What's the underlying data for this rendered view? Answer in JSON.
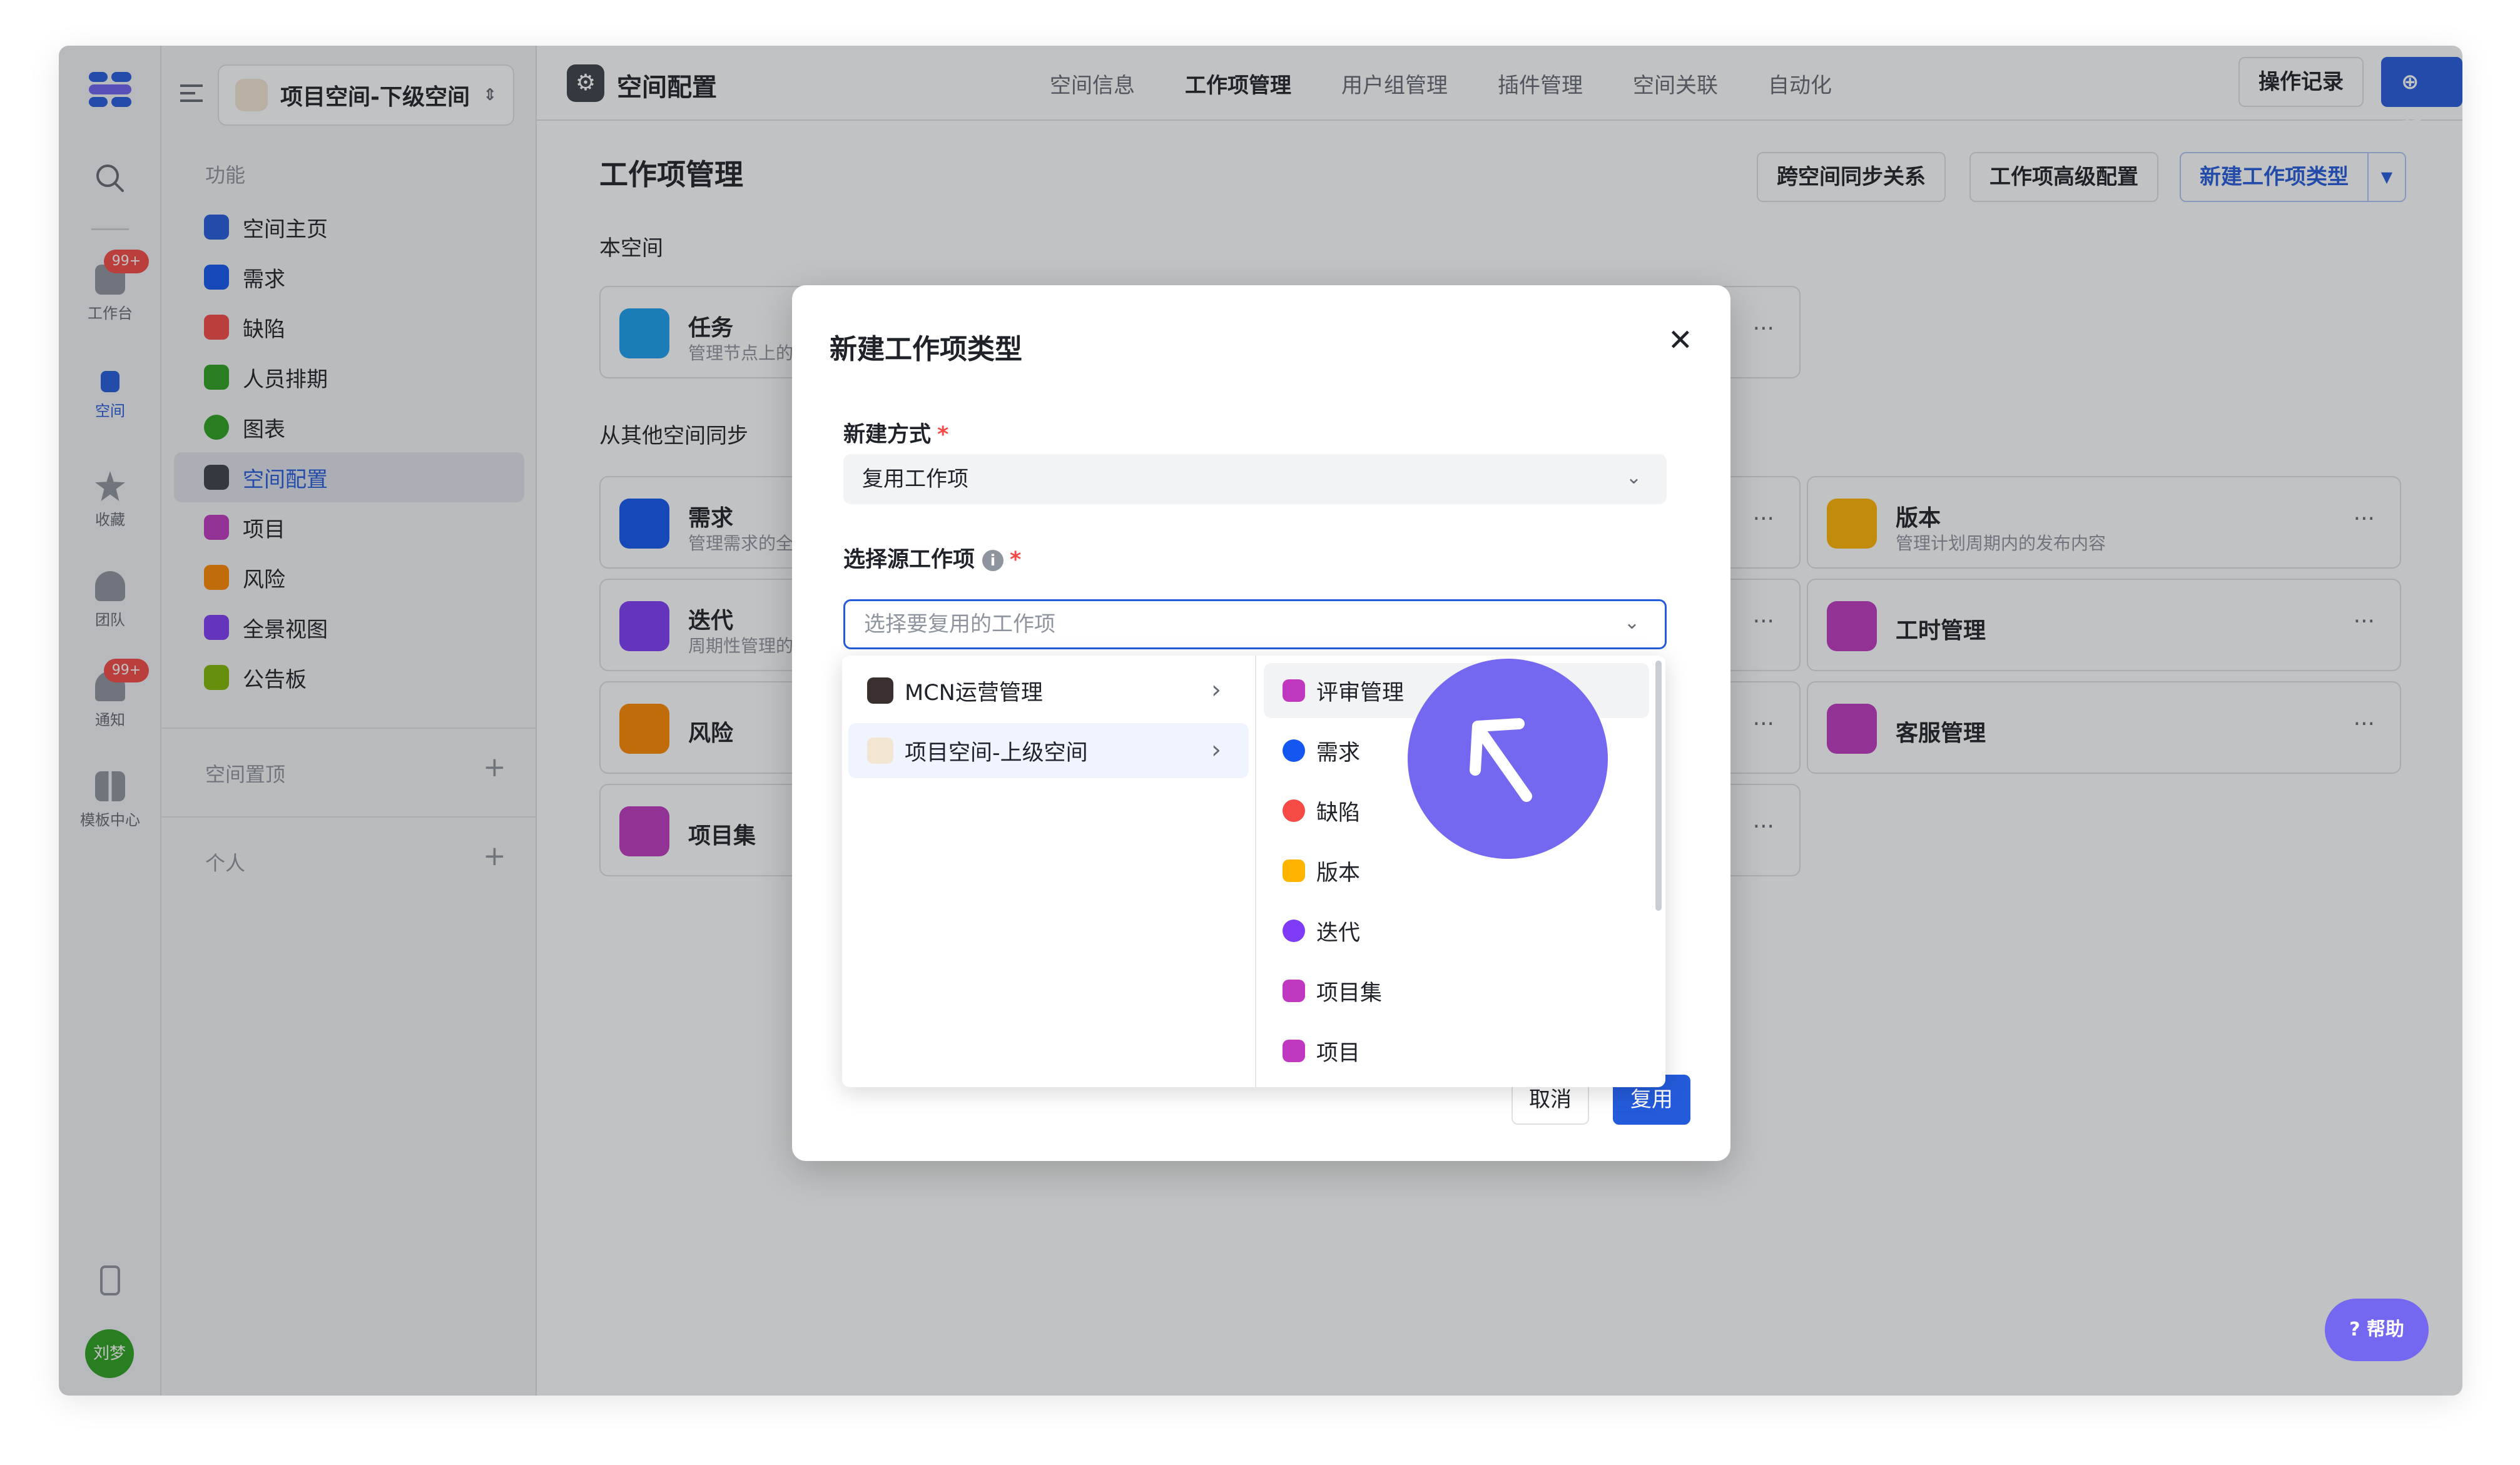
{
  "rail": {
    "items": [
      {
        "label": "工作台",
        "badge": "99+",
        "icon": "workbench-icon"
      },
      {
        "label": "空间",
        "icon": "space-icon"
      },
      {
        "label": "收藏",
        "icon": "star-icon"
      },
      {
        "label": "团队",
        "icon": "team-icon"
      },
      {
        "label": "通知",
        "badge": "99+",
        "icon": "bell-icon"
      },
      {
        "label": "模板中心",
        "icon": "template-icon"
      }
    ],
    "avatar": "刘梦"
  },
  "nav": {
    "space_name": "项目空间-下级空间",
    "section_function": "功能",
    "items": [
      {
        "label": "空间主页",
        "color": "#245bdb"
      },
      {
        "label": "需求",
        "color": "#1456f0"
      },
      {
        "label": "缺陷",
        "color": "#f54a45"
      },
      {
        "label": "人员排期",
        "color": "#2ea121"
      },
      {
        "label": "图表",
        "color": "#2ea121"
      },
      {
        "label": "空间配置",
        "color": "#3c4049"
      },
      {
        "label": "项目",
        "color": "#c038c0"
      },
      {
        "label": "风险",
        "color": "#ff8800"
      },
      {
        "label": "全景视图",
        "color": "#7f3bf5"
      },
      {
        "label": "公告板",
        "color": "#7fb800"
      }
    ],
    "section_pinned": "空间置顶",
    "section_personal": "个人"
  },
  "topbar": {
    "title": "空间配置",
    "tabs": [
      "空间信息",
      "工作项管理",
      "用户组管理",
      "插件管理",
      "空间关联",
      "自动化"
    ],
    "active_tab": "工作项管理",
    "log_button": "操作记录",
    "new_button": "新建"
  },
  "page": {
    "title": "工作项管理",
    "sync_button": "跨空间同步关系",
    "advanced_button": "工作项高级配置",
    "new_type_button": "新建工作项类型",
    "section_this": "本空间",
    "section_sync": "从其他空间同步",
    "cards_left": [
      {
        "name": "任务",
        "desc": "管理节点上的",
        "color": "#1a9ff0"
      },
      {
        "name": "需求",
        "desc": "管理需求的全",
        "color": "#1456f0"
      },
      {
        "name": "迭代",
        "desc": "周期性管理的",
        "color": "#7f3bf5"
      },
      {
        "name": "风险",
        "desc": "",
        "color": "#ff8800"
      },
      {
        "name": "项目集",
        "desc": "",
        "color": "#c038c0"
      }
    ],
    "cards_right": [
      {
        "name": "版本",
        "desc": "管理计划周期内的发布内容",
        "color": "#ffb400"
      },
      {
        "name": "工时管理",
        "desc": "",
        "color": "#c038c0"
      },
      {
        "name": "客服管理",
        "desc": "",
        "color": "#c038c0"
      }
    ],
    "more": "···"
  },
  "modal": {
    "title": "新建工作项类型",
    "close": "✕",
    "method_label": "新建方式",
    "method_value": "复用工作项",
    "source_label": "选择源工作项",
    "source_placeholder": "选择要复用的工作项",
    "required": "*",
    "info": "i",
    "cancel": "取消",
    "confirm": "复用"
  },
  "cascade": {
    "spaces": [
      {
        "label": "MCN运营管理"
      },
      {
        "label": "项目空间-上级空间"
      }
    ],
    "types": [
      {
        "label": "评审管理",
        "color": "#c038c0"
      },
      {
        "label": "需求",
        "color": "#1456f0"
      },
      {
        "label": "缺陷",
        "color": "#f54a45"
      },
      {
        "label": "版本",
        "color": "#ffb400"
      },
      {
        "label": "迭代",
        "color": "#7f3bf5"
      },
      {
        "label": "项目集",
        "color": "#c038c0"
      },
      {
        "label": "项目",
        "color": "#c038c0"
      }
    ]
  },
  "help": "帮助",
  "colors": {
    "accent": "#245bdb",
    "cursor": "#7467f0",
    "danger": "#f54a45"
  }
}
